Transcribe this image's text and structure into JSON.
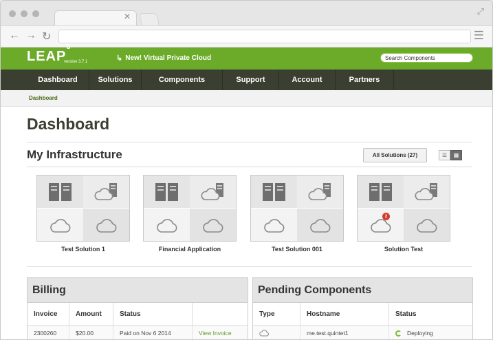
{
  "app": {
    "logo": "LEAP",
    "logo_sup": "3",
    "version": "version 3.7.1",
    "announcement": "New! Virtual Private Cloud",
    "search_placeholder": "Search Components"
  },
  "nav": {
    "items": [
      {
        "label": "Dashboard"
      },
      {
        "label": "Solutions"
      },
      {
        "label": "Components"
      },
      {
        "label": "Support"
      },
      {
        "label": "Account"
      },
      {
        "label": "Partners"
      }
    ]
  },
  "breadcrumb": "Dashboard",
  "page_title": "Dashboard",
  "infrastructure": {
    "title": "My Infrastructure",
    "all_solutions_label": "All Solutions (27)",
    "solutions": [
      {
        "label": "Test Solution 1",
        "badge": ""
      },
      {
        "label": "Financial Application",
        "badge": ""
      },
      {
        "label": "Test Solution 001",
        "badge": ""
      },
      {
        "label": "Solution Test",
        "badge": "2"
      }
    ]
  },
  "billing": {
    "title": "Billing",
    "columns": [
      "Invoice",
      "Amount",
      "Status",
      ""
    ],
    "rows": [
      {
        "invoice": "2300260",
        "amount": "$20.00",
        "status": "Paid on Nov 6 2014",
        "action": "View Invoice"
      }
    ]
  },
  "pending": {
    "title": "Pending Components",
    "columns": [
      "Type",
      "Hostname",
      "Status"
    ],
    "rows": [
      {
        "type_icon": "cloud-icon",
        "hostname": "me.test.quintet1",
        "status": "Deploying"
      }
    ]
  },
  "colors": {
    "brand_green": "#6cab29",
    "nav_dark": "#3b3f31",
    "badge_red": "#d73a2d"
  }
}
